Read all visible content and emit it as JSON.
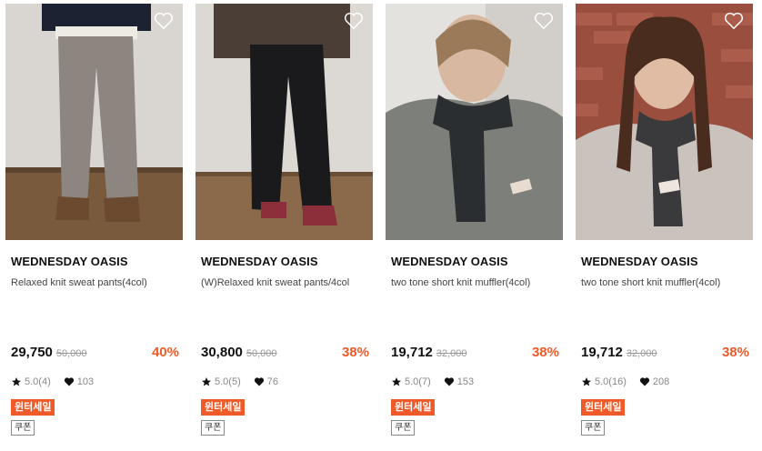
{
  "products": [
    {
      "brand": "WEDNESDAY OASIS",
      "name": "Relaxed knit sweat pants(4col)",
      "price": "29,750",
      "original_price": "50,000",
      "discount": "40%",
      "rating": "5.0(4)",
      "likes": "103",
      "badge": "윈터세일",
      "coupon": "쿠폰"
    },
    {
      "brand": "WEDNESDAY OASIS",
      "name": "(W)Relaxed knit sweat pants/4col",
      "price": "30,800",
      "original_price": "50,000",
      "discount": "38%",
      "rating": "5.0(5)",
      "likes": "76",
      "badge": "윈터세일",
      "coupon": "쿠폰"
    },
    {
      "brand": "WEDNESDAY OASIS",
      "name": "two tone short knit muffler(4col)",
      "price": "19,712",
      "original_price": "32,000",
      "discount": "38%",
      "rating": "5.0(7)",
      "likes": "153",
      "badge": "윈터세일",
      "coupon": "쿠폰"
    },
    {
      "brand": "WEDNESDAY OASIS",
      "name": "two tone short knit muffler(4col)",
      "price": "19,712",
      "original_price": "32,000",
      "discount": "38%",
      "rating": "5.0(16)",
      "likes": "208",
      "badge": "윈터세일",
      "coupon": "쿠폰"
    }
  ],
  "colors": {
    "accent": "#f05a28",
    "text": "#111111",
    "muted": "#888888"
  },
  "icons": [
    "heart-outline-icon",
    "star-icon",
    "heart-icon"
  ]
}
